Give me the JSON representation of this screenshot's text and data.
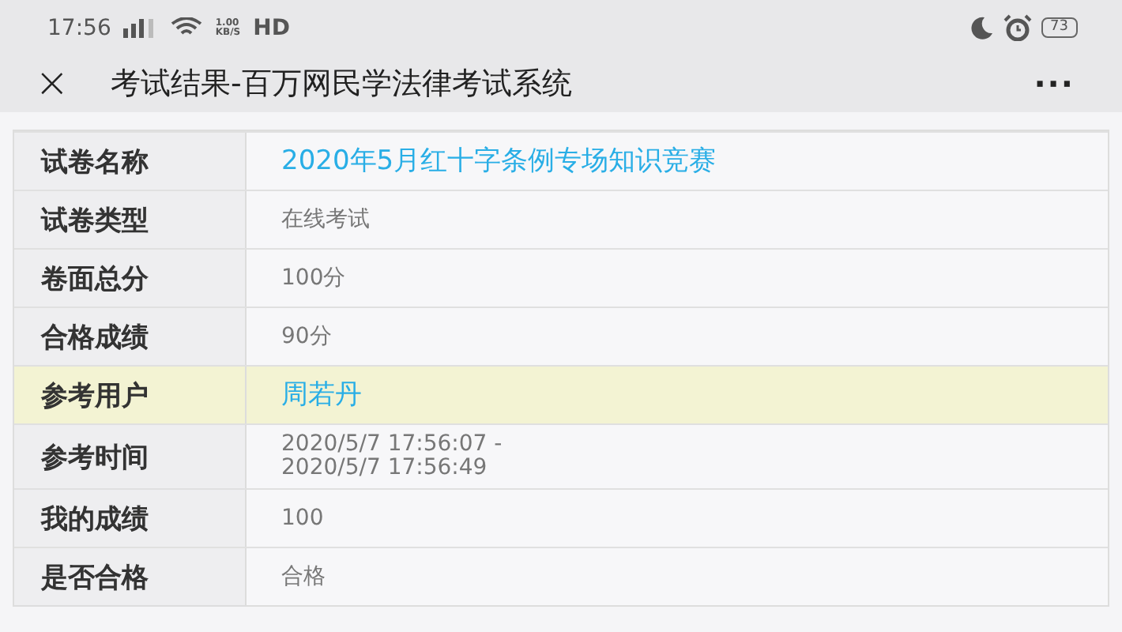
{
  "status_bar": {
    "time": "17:56",
    "speed_value": "1.00",
    "speed_unit": "KB/S",
    "network": "HD",
    "battery": "73"
  },
  "title_bar": {
    "close": "×",
    "title": "考试结果-百万网民学法律考试系统",
    "more": "···"
  },
  "rows": [
    {
      "label": "试卷名称",
      "value": "2020年5月红十字条例专场知识竞赛",
      "kind": "link",
      "highlighted": false
    },
    {
      "label": "试卷类型",
      "value": "在线考试",
      "kind": "text",
      "highlighted": false
    },
    {
      "label": "卷面总分",
      "value": "100分",
      "kind": "text",
      "highlighted": false
    },
    {
      "label": "合格成绩",
      "value": "90分",
      "kind": "text",
      "highlighted": false
    },
    {
      "label": "参考用户",
      "value": "周若丹",
      "kind": "link",
      "highlighted": true
    },
    {
      "label": "参考时间",
      "value": "2020/5/7 17:56:07 -\n2020/5/7 17:56:49",
      "kind": "text",
      "highlighted": false
    },
    {
      "label": "我的成绩",
      "value": "100",
      "kind": "text",
      "highlighted": false
    },
    {
      "label": "是否合格",
      "value": "合格",
      "kind": "text",
      "highlighted": false
    }
  ]
}
